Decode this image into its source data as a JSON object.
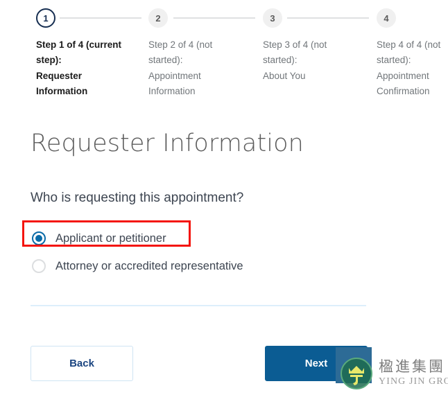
{
  "stepper": {
    "steps": [
      {
        "number": "1",
        "state": "current",
        "lines": [
          "Step 1 of 4 (current",
          "step):",
          "Requester",
          "Information"
        ]
      },
      {
        "number": "2",
        "state": "not-started",
        "lines": [
          "Step 2 of 4 (not",
          "started):",
          "Appointment",
          "Information"
        ]
      },
      {
        "number": "3",
        "state": "not-started",
        "lines": [
          "Step 3 of 4 (not",
          "started):",
          "About You"
        ]
      },
      {
        "number": "4",
        "state": "not-started",
        "lines": [
          "Step 4 of 4 (not",
          "started):",
          "Appointment",
          "Confirmation"
        ]
      }
    ]
  },
  "main": {
    "title": "Requester Information",
    "question": "Who is requesting this appointment?",
    "radio_options": [
      {
        "label": "Applicant or petitioner",
        "selected": true,
        "highlighted": true
      },
      {
        "label": "Attorney or accredited representative",
        "selected": false,
        "highlighted": false
      }
    ]
  },
  "footer": {
    "back_label": "Back",
    "next_label": "Next"
  },
  "watermark": {
    "chinese": "楹進集團",
    "english": "YING JIN GROUP"
  },
  "colors": {
    "current_step": "#162e51",
    "inactive_step_bg": "#f0f0f0",
    "inactive_text": "#71767a",
    "radio_selected": "#0a6ba8",
    "highlight_red": "#f4140c",
    "next_button_bg": "#0b5c93",
    "back_button_text": "#1a4480",
    "divider": "#ddeffb"
  }
}
